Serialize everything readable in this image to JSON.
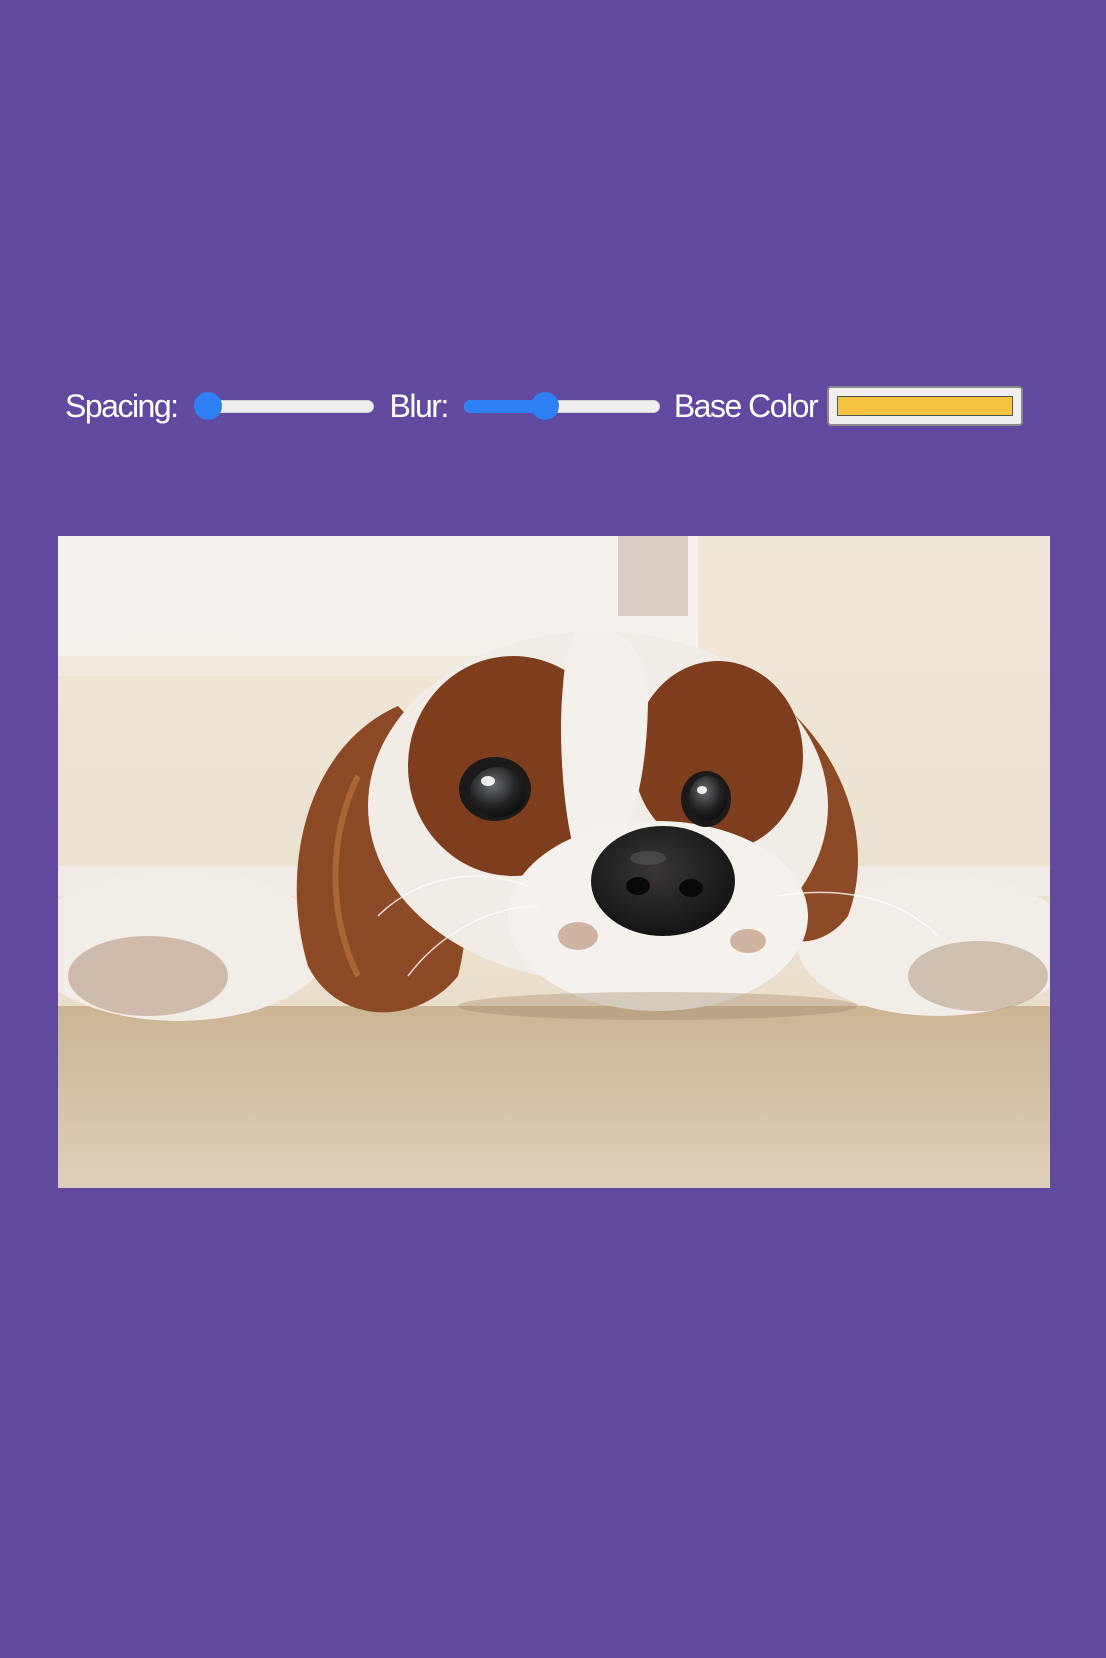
{
  "controls": {
    "spacing": {
      "label": "Spacing:",
      "value_fraction": 0.0
    },
    "blur": {
      "label": "Blur:",
      "value_fraction": 0.4
    },
    "base_color": {
      "label": "Base Color",
      "value": "#f5c342"
    }
  },
  "colors": {
    "background": "#6249a0",
    "slider_accent": "#2f7ff5"
  },
  "image": {
    "subject": "dog-photo"
  }
}
